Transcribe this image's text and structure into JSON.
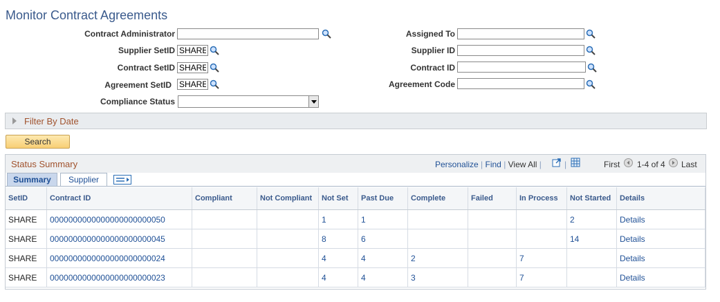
{
  "page_title": "Monitor Contract Agreements",
  "form": {
    "contract_administrator": {
      "label": "Contract Administrator",
      "value": ""
    },
    "supplier_setid": {
      "label": "Supplier SetID",
      "value": "SHARE"
    },
    "contract_setid": {
      "label": "Contract SetID",
      "value": "SHARE"
    },
    "agreement_setid": {
      "label": "Agreement SetID",
      "value": "SHARE"
    },
    "compliance_status": {
      "label": "Compliance Status",
      "value": ""
    },
    "assigned_to": {
      "label": "Assigned To",
      "value": ""
    },
    "supplier_id": {
      "label": "Supplier ID",
      "value": ""
    },
    "contract_id": {
      "label": "Contract ID",
      "value": ""
    },
    "agreement_code": {
      "label": "Agreement Code",
      "value": ""
    }
  },
  "filter_section": {
    "label": "Filter By Date"
  },
  "search_button": "Search",
  "grid": {
    "title": "Status Summary",
    "personalize": "Personalize",
    "find": "Find",
    "view_all": "View All",
    "first": "First",
    "range": "1-4 of 4",
    "last": "Last",
    "tabs": [
      {
        "label": "Summary",
        "active": true
      },
      {
        "label": "Supplier",
        "active": false
      }
    ],
    "columns": [
      "SetID",
      "Contract ID",
      "Compliant",
      "Not Compliant",
      "Not Set",
      "Past Due",
      "Complete",
      "Failed",
      "In Process",
      "Not Started",
      "Details"
    ],
    "rows": [
      {
        "setid": "SHARE",
        "contract_id": "0000000000000000000000050",
        "compliant": "",
        "not_compliant": "",
        "not_set": "1",
        "past_due": "1",
        "complete": "",
        "failed": "",
        "in_process": "",
        "not_started": "2",
        "details": "Details"
      },
      {
        "setid": "SHARE",
        "contract_id": "0000000000000000000000045",
        "compliant": "",
        "not_compliant": "",
        "not_set": "8",
        "past_due": "6",
        "complete": "",
        "failed": "",
        "in_process": "",
        "not_started": "14",
        "details": "Details"
      },
      {
        "setid": "SHARE",
        "contract_id": "0000000000000000000000024",
        "compliant": "",
        "not_compliant": "",
        "not_set": "4",
        "past_due": "4",
        "complete": "2",
        "failed": "",
        "in_process": "7",
        "not_started": "",
        "details": "Details"
      },
      {
        "setid": "SHARE",
        "contract_id": "0000000000000000000000023",
        "compliant": "",
        "not_compliant": "",
        "not_set": "4",
        "past_due": "4",
        "complete": "3",
        "failed": "",
        "in_process": "7",
        "not_started": "",
        "details": "Details"
      }
    ]
  },
  "icons": {
    "lookup": "magnifier-icon",
    "zoom": "zoom-icon",
    "download": "download-icon",
    "prev": "prev-arrow-icon",
    "next": "next-arrow-icon",
    "show_all_columns": "show-all-columns-icon"
  }
}
